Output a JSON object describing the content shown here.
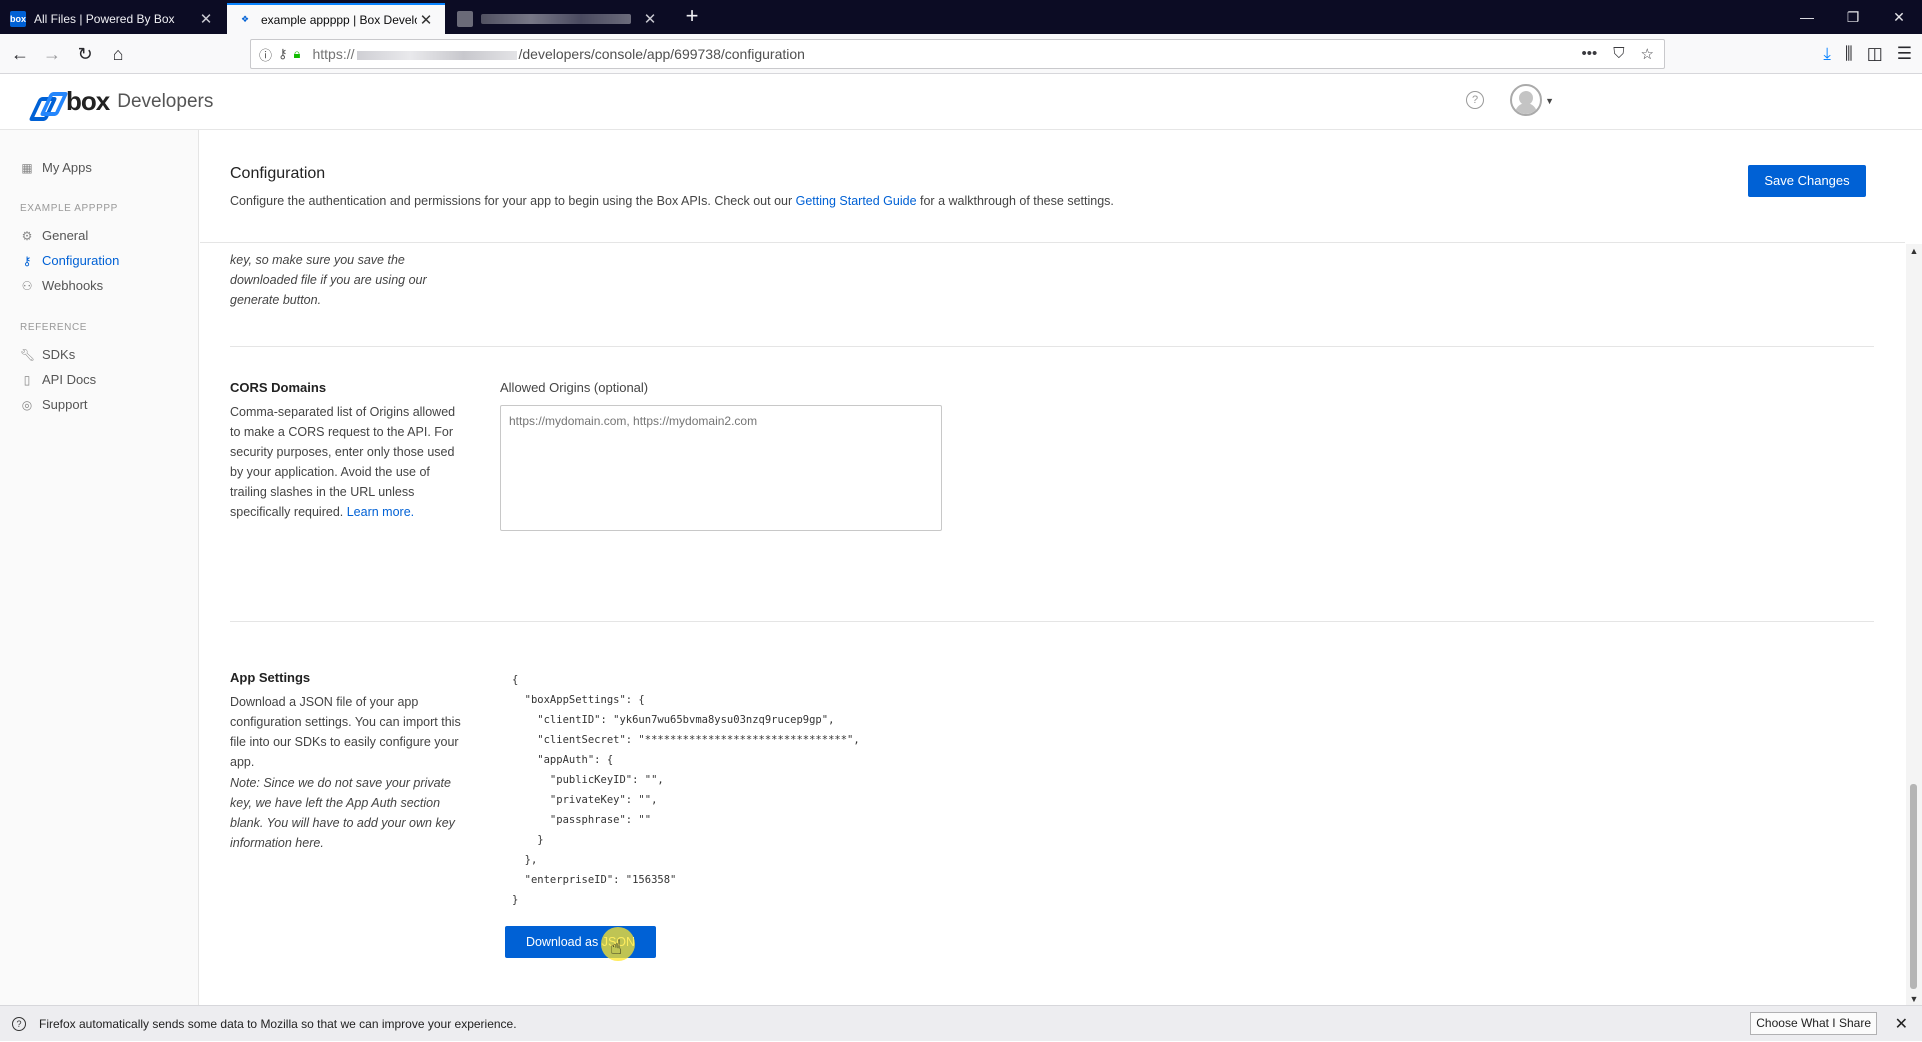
{
  "browser": {
    "tabs": [
      {
        "title": "All Files | Powered By Box",
        "favicon": "box-favicon",
        "active": false
      },
      {
        "title": "example appppp | Box Develop",
        "favicon": "box-dev-favicon",
        "active": true
      },
      {
        "title": "",
        "favicon": "blurred-favicon",
        "active": false
      }
    ],
    "url": {
      "prefix": "https://",
      "path": "/developers/console/app/699738/configuration"
    }
  },
  "header": {
    "logo_box": "box",
    "logo_dev": "Developers"
  },
  "sidebar": {
    "my_apps": "My Apps",
    "app_heading": "EXAMPLE APPPPP",
    "app_items": [
      {
        "label": "General",
        "icon": "gear-icon"
      },
      {
        "label": "Configuration",
        "icon": "key-icon",
        "active": true
      },
      {
        "label": "Webhooks",
        "icon": "webhook-icon"
      }
    ],
    "ref_heading": "REFERENCE",
    "ref_items": [
      {
        "label": "SDKs",
        "icon": "wrench-icon"
      },
      {
        "label": "API Docs",
        "icon": "document-icon"
      },
      {
        "label": "Support",
        "icon": "lifebuoy-icon"
      }
    ]
  },
  "main": {
    "title": "Configuration",
    "desc_before": "Configure the authentication and permissions for your app to begin using the Box APIs. Check out our ",
    "desc_link": "Getting Started Guide",
    "desc_after": " for a walkthrough of these settings.",
    "save_label": "Save Changes",
    "keypair_note_lines": [
      "key, so make sure you save the",
      "downloaded file if you are using our",
      "generate button."
    ],
    "cors": {
      "title": "CORS Domains",
      "desc": "Comma-separated list of Origins allowed to make a CORS request to the API. For security purposes, enter only those used by your application. Avoid the use of trailing slashes in the URL unless specifically required. ",
      "learn_more": "Learn more.",
      "field_label": "Allowed Origins (optional)",
      "placeholder": "https://mydomain.com, https://mydomain2.com"
    },
    "app_settings": {
      "title": "App Settings",
      "desc": "Download a JSON file of your app configuration settings. You can import this file into our SDKs to easily configure your app.",
      "note": "Note: Since we do not save your private key, we have left the App Auth section blank. You will have to add your own key information here.",
      "json_lines": [
        "{",
        "  \"boxAppSettings\": {",
        "    \"clientID\": \"yk6un7wu65bvma8ysu03nzq9rucep9gp\",",
        "    \"clientSecret\": \"********************************\",",
        "    \"appAuth\": {",
        "      \"publicKeyID\": \"\",",
        "      \"privateKey\": \"\",",
        "      \"passphrase\": \"\"",
        "    }",
        "  },",
        "  \"enterpriseID\": \"156358\"",
        "}"
      ],
      "download_label": "Download as JSON"
    }
  },
  "notification": {
    "text": "Firefox automatically sends some data to Mozilla so that we can improve your experience.",
    "button": "Choose What I Share"
  }
}
